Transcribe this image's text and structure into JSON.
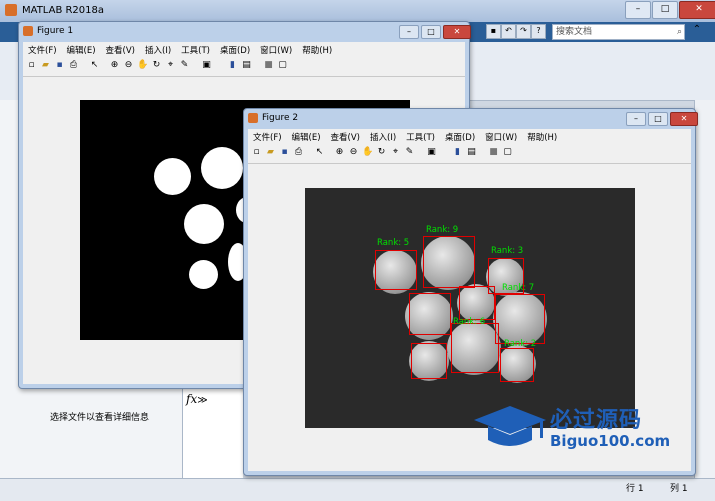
{
  "app": {
    "title": "MATLAB R2018a",
    "search_placeholder": "搜索文档",
    "details_text": "选择文件以查看详细信息",
    "fx_label": "fx",
    "fx_arrows": "≫",
    "status": {
      "row_label": "行",
      "row_value": "1",
      "col_label": "列",
      "col_value": "1"
    }
  },
  "figure_menu": [
    "文件(F)",
    "编辑(E)",
    "查看(V)",
    "插入(I)",
    "工具(T)",
    "桌面(D)",
    "窗口(W)",
    "帮助(H)"
  ],
  "figure1": {
    "title": "Figure 1"
  },
  "figure2": {
    "title": "Figure 2",
    "ranks": [
      "Rank: 5",
      "Rank: 9",
      "Rank: 3",
      "Rank: 7",
      "Rank: 6",
      "Rank: 2"
    ]
  },
  "watermark": {
    "big": "必过源码",
    "small": "Biguo100.com"
  },
  "colors": {
    "accent": "#2a5e97",
    "rank_text": "#00e000",
    "rank_box": "#e00000"
  }
}
